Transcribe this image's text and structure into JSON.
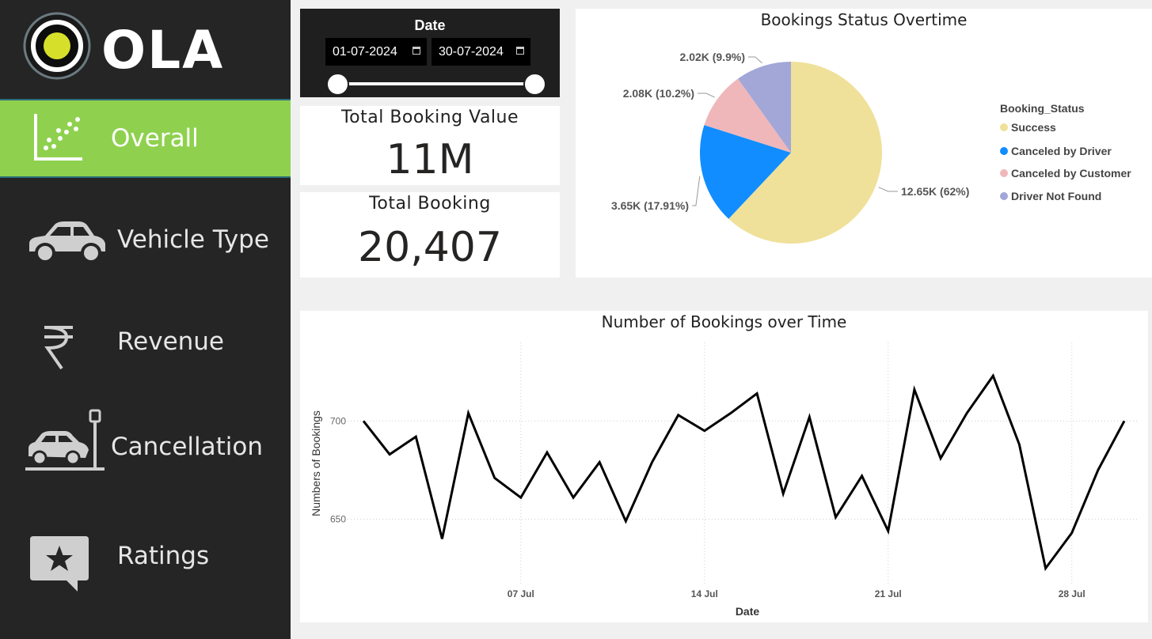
{
  "brand": {
    "name": "OLA"
  },
  "nav": [
    {
      "label": "Overall",
      "icon": "scatter-chart-icon",
      "active": true
    },
    {
      "label": "Vehicle Type",
      "icon": "car-icon",
      "active": false
    },
    {
      "label": "Revenue",
      "icon": "rupee-icon",
      "active": false
    },
    {
      "label": "Cancellation",
      "icon": "car-crash-icon",
      "active": false
    },
    {
      "label": "Ratings",
      "icon": "star-comment-icon",
      "active": false
    }
  ],
  "date_filter": {
    "title": "Date",
    "start": "01-07-2024",
    "end": "30-07-2024",
    "range_fraction": [
      0,
      1
    ]
  },
  "kpis": {
    "total_booking_value": {
      "title": "Total Booking Value",
      "value": "11M"
    },
    "total_booking": {
      "title": "Total Booking",
      "value": "20,407"
    }
  },
  "colors": {
    "sidebar_bg": "#252525",
    "active_nav": "#8fd14f",
    "success": "#efe19a",
    "canceled_driver": "#118dff",
    "canceled_customer": "#efb7b9",
    "driver_not_found": "#a2a7d8"
  },
  "chart_data": [
    {
      "type": "pie",
      "title": "Bookings Status Overtime",
      "legend_title": "Booking_Status",
      "legend_position": "right",
      "slices": [
        {
          "name": "Success",
          "value": 12650,
          "label": "12.65K (62%)",
          "percent": 62,
          "color": "#efe19a"
        },
        {
          "name": "Canceled by Driver",
          "value": 3650,
          "label": "3.65K (17.91%)",
          "percent": 17.91,
          "color": "#118dff"
        },
        {
          "name": "Canceled by Customer",
          "value": 2080,
          "label": "2.08K (10.2%)",
          "percent": 10.2,
          "color": "#efb7b9"
        },
        {
          "name": "Driver Not Found",
          "value": 2020,
          "label": "2.02K (9.9%)",
          "percent": 9.9,
          "color": "#a2a7d8"
        }
      ]
    },
    {
      "type": "line",
      "title": "Number of Bookings over Time",
      "xlabel": "Date",
      "ylabel": "Numbers of Bookings",
      "x_ticks": [
        "07 Jul",
        "14 Jul",
        "21 Jul",
        "28 Jul"
      ],
      "x_tick_days": [
        7,
        14,
        21,
        28
      ],
      "xlim": [
        1,
        30
      ],
      "y_ticks": [
        650,
        700
      ],
      "ylim": [
        620,
        740
      ],
      "grid": true,
      "days": [
        1,
        2,
        3,
        4,
        5,
        6,
        7,
        8,
        9,
        10,
        11,
        12,
        13,
        14,
        15,
        16,
        17,
        18,
        19,
        20,
        21,
        22,
        23,
        24,
        25,
        26,
        27,
        28,
        29,
        30
      ],
      "values": [
        700,
        683,
        692,
        640,
        704,
        671,
        661,
        684,
        661,
        679,
        649,
        679,
        703,
        695,
        704,
        714,
        663,
        702,
        651,
        672,
        644,
        716,
        681,
        704,
        723,
        688,
        625,
        643,
        675,
        700
      ]
    }
  ]
}
